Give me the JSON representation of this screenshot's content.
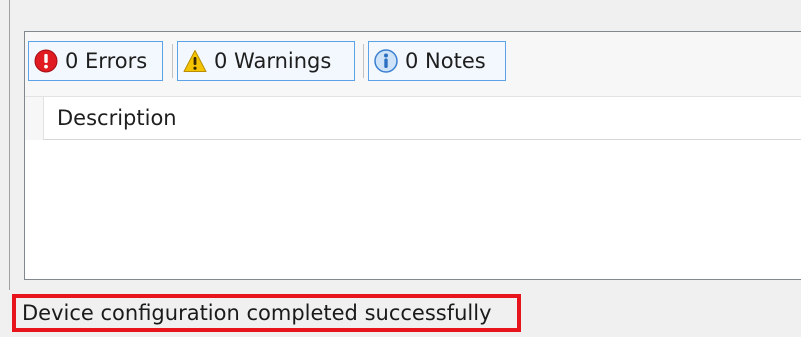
{
  "error_list": {
    "filters": {
      "errors": {
        "label": "0 Errors",
        "icon": "error-icon",
        "color": "#e11b22"
      },
      "warnings": {
        "label": "0 Warnings",
        "icon": "warning-icon",
        "color": "#f5c400"
      },
      "notes": {
        "label": "0 Notes",
        "icon": "info-icon",
        "color": "#3a7fd0"
      }
    },
    "columns": [
      "Description"
    ],
    "rows": []
  },
  "status_bar": {
    "message": "Device configuration completed successfully",
    "highlight_color": "#e8141b"
  }
}
